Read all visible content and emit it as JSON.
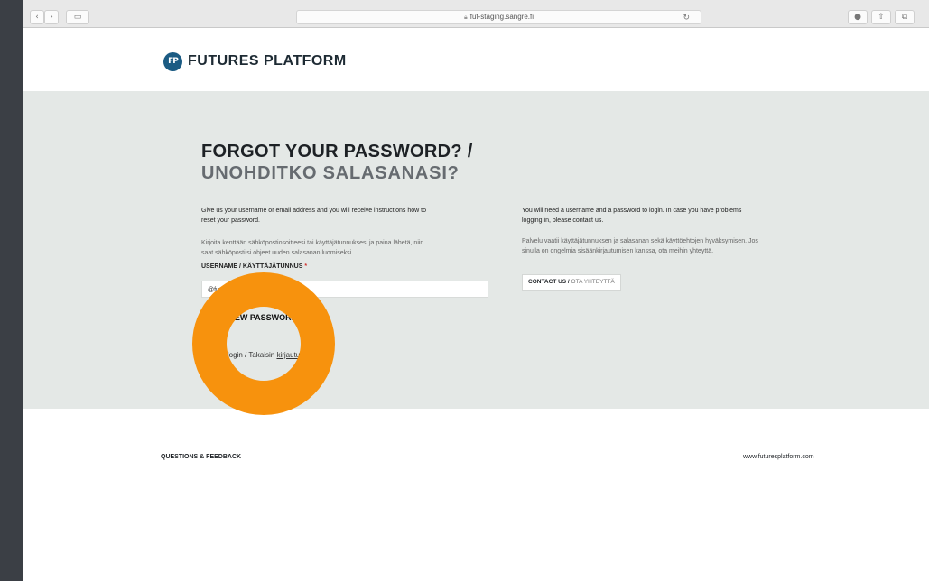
{
  "browser": {
    "url": "fut-staging.sangre.fi",
    "lock_icon": "lock-icon",
    "back_icon": "‹",
    "forward_icon": "›",
    "sidebar_icon": "▭",
    "reload_icon": "↻",
    "info_icon": "●",
    "share_icon": "⇧",
    "tabs_icon": "⧉"
  },
  "header": {
    "logo_mark": "FP",
    "logo_text": "FUTURES PLATFORM"
  },
  "forgot": {
    "title_en": "FORGOT YOUR PASSWORD? /",
    "title_fi": "UNOHDITKO SALASANASI?",
    "intro_en_1": "Give us your username or email address and you will receive instructions how to",
    "intro_en_2": "reset your password.",
    "intro_fi_1": "Kirjoita kenttään sähköpostiosoitteesi tai käyttäjätunnuksesi ja paina lähetä, niin",
    "intro_fi_2": "saat sähköpostiisi ohjeet uuden salasanan luomiseksi.",
    "field_label": "USERNAME / KÄYTTÄJÄTUNNUS",
    "required_mark": "*",
    "input_value": "@futuresplatform.com",
    "submit_label": "EMAIL NEW PASSWORD",
    "back_prefix": "Back to login / Takaisin ",
    "back_link": "kirjautumissivulle"
  },
  "info": {
    "text_en_1": "You will need a username and a password to login. In case you have problems",
    "text_en_2": "logging in, please contact us.",
    "text_fi_1": "Palvelu vaatii käyttäjätunnuksen ja salasanan sekä käyttöehtojen hyväksymisen. Jos",
    "text_fi_2": "sinulla on ongelmia sisäänkirjautumisen kanssa, ota meihin yhteyttä.",
    "contact_en": "CONTACT US / ",
    "contact_fi": "OTA YHTEYTTÄ"
  },
  "footer": {
    "left": "QUESTIONS & FEEDBACK",
    "right": "www.futuresplatform.com"
  },
  "colors": {
    "brand": "#1b5b83",
    "band": "#e4e8e6",
    "overlay_ring": "#f7920d",
    "required": "#d0312d"
  }
}
